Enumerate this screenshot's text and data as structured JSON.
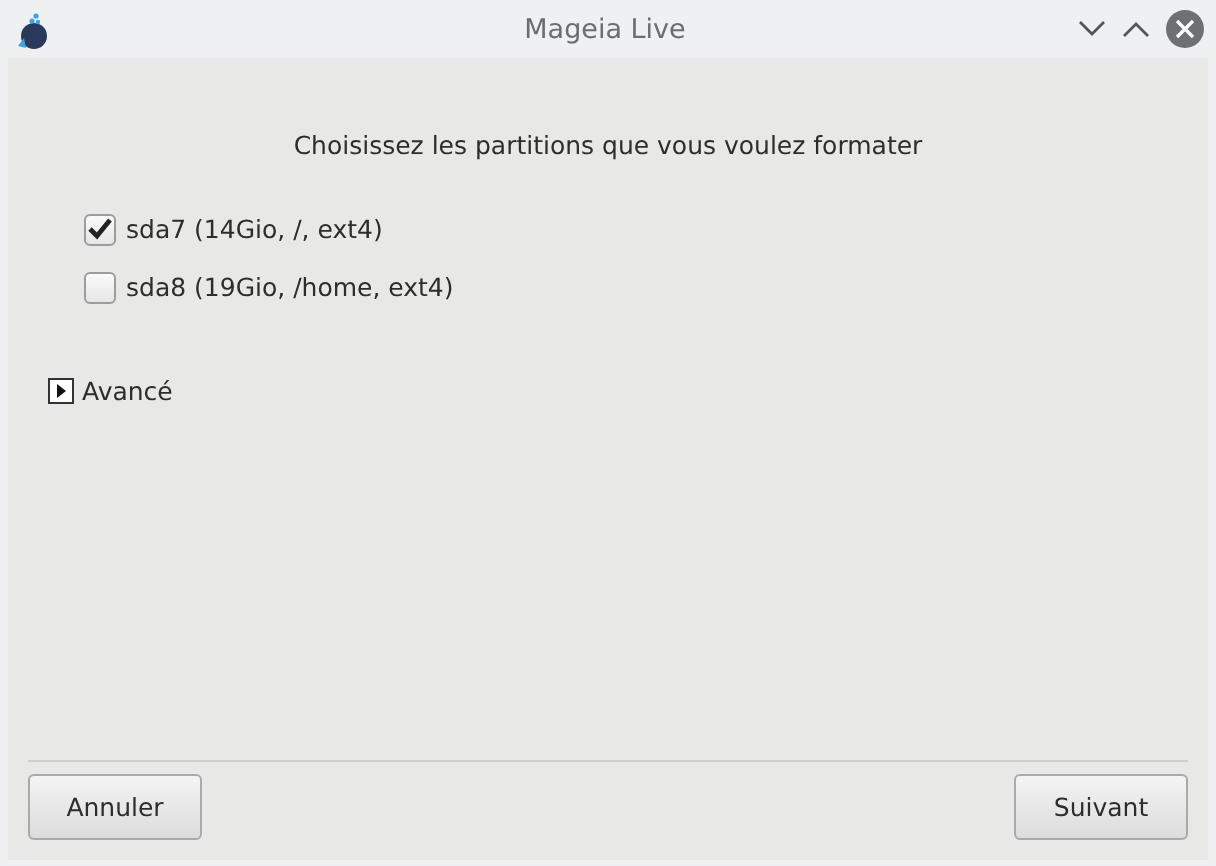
{
  "window": {
    "title": "Mageia Live"
  },
  "heading": "Choisissez les partitions que vous voulez formater",
  "partitions": [
    {
      "label": "sda7 (14Gio, /, ext4)",
      "checked": true
    },
    {
      "label": "sda8 (19Gio, /home, ext4)",
      "checked": false
    }
  ],
  "advanced": {
    "label": "Avancé",
    "expanded": false
  },
  "buttons": [
    "Annuler",
    "Suivant"
  ]
}
